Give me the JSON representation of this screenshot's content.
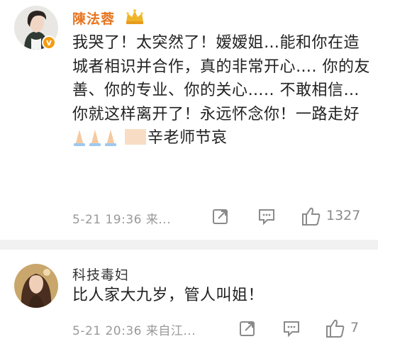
{
  "comments": [
    {
      "username": "陳法蓉",
      "verified": true,
      "text_before_emoji": "我哭了！太突然了！嫒嫒姐…能和你在造城者相识并合作，真的非常开心…. 你的友善、你的专业、你的关心….. 不敢相信…你就这样离开了！永远怀念你！一路走好",
      "text_after_emoji": "辛老师节哀",
      "time": "5-21 19:36",
      "source": "来...",
      "like_count": "1327",
      "icons": [
        "forward-icon",
        "comment-icon",
        "like-icon"
      ]
    },
    {
      "username": "科技毒妇",
      "text": "比人家大九岁，管人叫姐！",
      "time": "5-21 20:36",
      "source": "来自江...",
      "like_count": "7",
      "icons": [
        "forward-icon",
        "comment-icon",
        "like-icon"
      ]
    }
  ],
  "colors": {
    "username_highlight": "#e8741e",
    "meta_gray": "#9a9a9a",
    "divider": "#f1f1f1"
  }
}
